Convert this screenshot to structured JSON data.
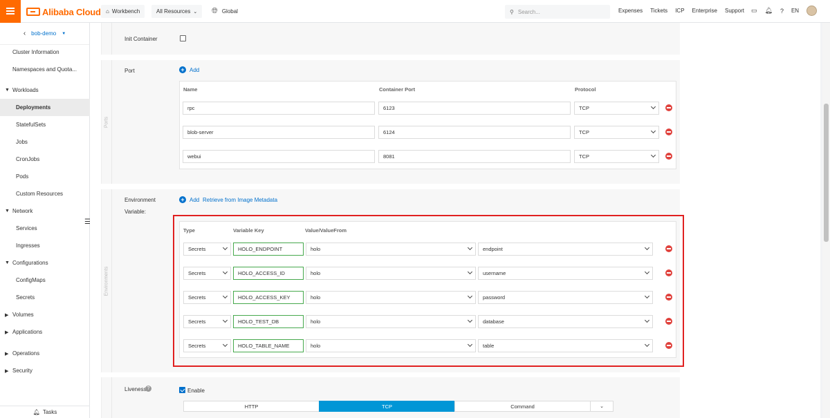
{
  "header": {
    "logo_text": "Alibaba Cloud",
    "workbench": "Workbench",
    "all_resources": "All Resources",
    "global": "Global",
    "search_placeholder": "Search...",
    "links": [
      "Expenses",
      "Tickets",
      "ICP",
      "Enterprise",
      "Support"
    ],
    "lang": "EN",
    "brand_color": "#ff6a00"
  },
  "sidebar": {
    "cluster": "bob-demo",
    "items": [
      {
        "label": "Cluster Information"
      },
      {
        "label": "Namespaces and Quota..."
      },
      {
        "label": "Workloads"
      },
      {
        "label": "Deployments"
      },
      {
        "label": "StatefulSets"
      },
      {
        "label": "Jobs"
      },
      {
        "label": "CronJobs"
      },
      {
        "label": "Pods"
      },
      {
        "label": "Custom Resources"
      },
      {
        "label": "Network"
      },
      {
        "label": "Services"
      },
      {
        "label": "Ingresses"
      },
      {
        "label": "Configurations"
      },
      {
        "label": "ConfigMaps"
      },
      {
        "label": "Secrets"
      },
      {
        "label": "Volumes"
      },
      {
        "label": "Applications"
      },
      {
        "label": "Operations"
      },
      {
        "label": "Security"
      }
    ],
    "tasks": "Tasks"
  },
  "init_container": {
    "label": "Init Container"
  },
  "ports": {
    "side_label": "Ports",
    "label": "Port",
    "add": "Add",
    "headers": {
      "name": "Name",
      "container_port": "Container Port",
      "protocol": "Protocol"
    },
    "rows": [
      {
        "name": "rpc",
        "port": "6123",
        "protocol": "TCP"
      },
      {
        "name": "blob-server",
        "port": "6124",
        "protocol": "TCP"
      },
      {
        "name": "webui",
        "port": "8081",
        "protocol": "TCP"
      }
    ]
  },
  "environments": {
    "side_label": "Environments",
    "label_line1": "Environment",
    "label_line2": "Variable:",
    "add": "Add",
    "retrieve": "Retrieve from Image Metadata",
    "headers": {
      "type": "Type",
      "key": "Variable Key",
      "value": "Value/ValueFrom"
    },
    "rows": [
      {
        "type": "Secrets",
        "key": "HOLO_ENDPOINT",
        "secret": "holo",
        "item": "endpoint"
      },
      {
        "type": "Secrets",
        "key": "HOLO_ACCESS_ID",
        "secret": "holo",
        "item": "username"
      },
      {
        "type": "Secrets",
        "key": "HOLO_ACCESS_KEY",
        "secret": "holo",
        "item": "password"
      },
      {
        "type": "Secrets",
        "key": "HOLO_TEST_DB",
        "secret": "holo",
        "item": "database"
      },
      {
        "type": "Secrets",
        "key": "HOLO_TABLE_NAME",
        "secret": "holo",
        "item": "table"
      }
    ]
  },
  "liveness": {
    "label": "Liveness",
    "enable": "Enable",
    "tabs": [
      "HTTP",
      "TCP",
      "Command"
    ]
  }
}
